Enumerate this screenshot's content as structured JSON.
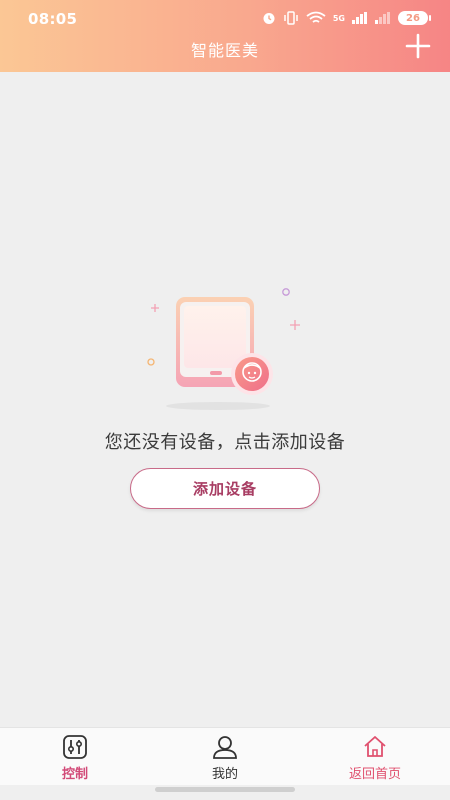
{
  "status_bar": {
    "time": "08:05",
    "signal_label": "5G",
    "battery": "26"
  },
  "header": {
    "title": "智能医美",
    "add_icon": "plus-icon"
  },
  "empty_state": {
    "illustration": "phone-with-face-icon",
    "message": "您还没有设备，点击添加设备",
    "button_label": "添加设备"
  },
  "tabbar": {
    "tabs": [
      {
        "label": "控制",
        "icon": "sliders-icon",
        "active": true
      },
      {
        "label": "我的",
        "icon": "user-icon",
        "active": false
      },
      {
        "label": "返回首页",
        "icon": "home-icon",
        "active": false
      }
    ]
  },
  "colors": {
    "header_gradient_start": "#fbc795",
    "header_gradient_end": "#f68585",
    "accent": "#d24a78",
    "button_text": "#a83d63",
    "background": "#efefef"
  }
}
